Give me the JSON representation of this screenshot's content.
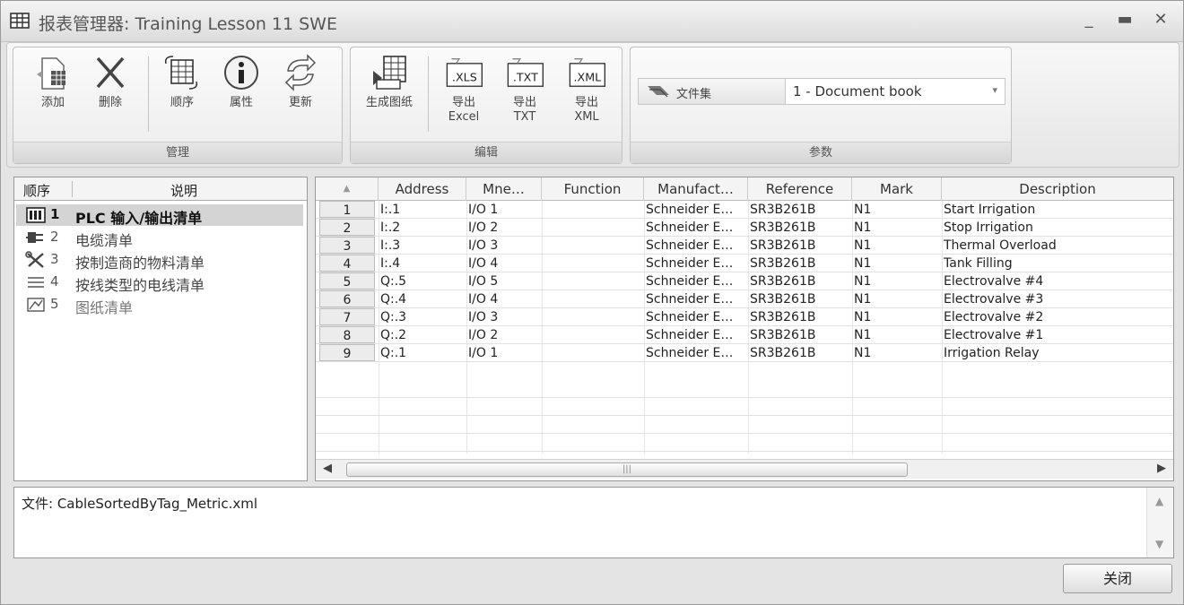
{
  "window": {
    "title": "报表管理器: Training Lesson 11 SWE",
    "controls": {
      "minimize": "_",
      "maximize": "▬",
      "close": "✕"
    }
  },
  "ribbon": {
    "groups": {
      "manage": {
        "label": "管理",
        "buttons": [
          {
            "label": "添加",
            "icon": "add-icon"
          },
          {
            "label": "删除",
            "icon": "delete-icon"
          },
          {
            "label": "顺序",
            "icon": "order-icon"
          },
          {
            "label": "属性",
            "icon": "info-icon"
          },
          {
            "label": "更新",
            "icon": "refresh-icon"
          }
        ]
      },
      "edit": {
        "label": "编辑",
        "buttons": [
          {
            "label": "生成图纸",
            "icon": "generate-drawing-icon"
          },
          {
            "label_line1": "导出",
            "label_line2": "Excel",
            "badge": ".XLS",
            "icon": "export-excel-icon"
          },
          {
            "label_line1": "导出",
            "label_line2": "TXT",
            "badge": ".TXT",
            "icon": "export-txt-icon"
          },
          {
            "label_line1": "导出",
            "label_line2": "XML",
            "badge": ".XML",
            "icon": "export-xml-icon"
          }
        ]
      },
      "params": {
        "label": "参数",
        "field_label": "文件集",
        "selected": "1 - Document book",
        "arrow": "▾"
      }
    }
  },
  "tree": {
    "headers": {
      "order": "顺序",
      "description": "说明"
    },
    "items": [
      {
        "num": "1",
        "label": "PLC 输入/输出清单",
        "icon": "plc-icon",
        "selected": true
      },
      {
        "num": "2",
        "label": "电缆清单",
        "icon": "cable-icon",
        "selected": false
      },
      {
        "num": "3",
        "label": "按制造商的物料清单",
        "icon": "tools-icon",
        "selected": false
      },
      {
        "num": "4",
        "label": "按线类型的电线清单",
        "icon": "wire-list-icon",
        "selected": false
      },
      {
        "num": "5",
        "label": "图纸清单",
        "icon": "drawing-list-icon",
        "selected": false
      }
    ]
  },
  "grid": {
    "sort_indicator": "▲",
    "headers": [
      "Address",
      "Mne…",
      "Function",
      "Manufact…",
      "Reference",
      "Mark",
      "Description"
    ],
    "rows": [
      [
        "1",
        "I:.1",
        "I/O 1",
        "",
        "Schneider E…",
        "SR3B261B",
        "N1",
        "Start Irrigation"
      ],
      [
        "2",
        "I:.2",
        "I/O 2",
        "",
        "Schneider E…",
        "SR3B261B",
        "N1",
        "Stop Irrigation"
      ],
      [
        "3",
        "I:.3",
        "I/O 3",
        "",
        "Schneider E…",
        "SR3B261B",
        "N1",
        "Thermal Overload"
      ],
      [
        "4",
        "I:.4",
        "I/O 4",
        "",
        "Schneider E…",
        "SR3B261B",
        "N1",
        "Tank Filling"
      ],
      [
        "5",
        "Q:.5",
        "I/O 5",
        "",
        "Schneider E…",
        "SR3B261B",
        "N1",
        "Electrovalve #4"
      ],
      [
        "6",
        "Q:.4",
        "I/O 4",
        "",
        "Schneider E…",
        "SR3B261B",
        "N1",
        "Electrovalve #3"
      ],
      [
        "7",
        "Q:.3",
        "I/O 3",
        "",
        "Schneider E…",
        "SR3B261B",
        "N1",
        "Electrovalve #2"
      ],
      [
        "8",
        "Q:.2",
        "I/O 2",
        "",
        "Schneider E…",
        "SR3B261B",
        "N1",
        "Electrovalve #1"
      ],
      [
        "9",
        "Q:.1",
        "I/O 1",
        "",
        "Schneider E…",
        "SR3B261B",
        "N1",
        "Irrigation Relay"
      ]
    ],
    "scroll": {
      "left": "◀",
      "right": "▶",
      "thumb": "|||"
    }
  },
  "message": {
    "text": "文件: CableSortedByTag_Metric.xml",
    "scroll_up": "▲",
    "scroll_down": "▼"
  },
  "footer": {
    "close_label": "关闭"
  }
}
